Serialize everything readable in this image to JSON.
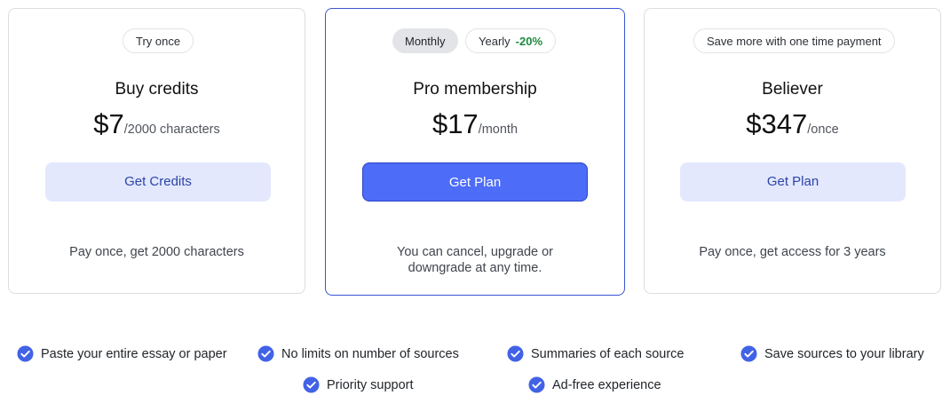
{
  "plans": [
    {
      "badge": "Try once",
      "title": "Buy credits",
      "price": "$7",
      "unit": "/2000 characters",
      "cta": "Get Credits",
      "description": "Pay once, get 2000 characters"
    },
    {
      "toggle": {
        "monthly": "Monthly",
        "yearly": "Yearly",
        "discount": "-20%"
      },
      "title": "Pro membership",
      "price": "$17",
      "unit": "/month",
      "cta": "Get Plan",
      "description_line1": "You can cancel, upgrade or",
      "description_line2": "downgrade at any time."
    },
    {
      "badge": "Save more with one time payment",
      "title": "Believer",
      "price": "$347",
      "unit": "/once",
      "cta": "Get Plan",
      "description": "Pay once, get access for 3 years"
    }
  ],
  "features": [
    "Paste your entire essay or paper",
    "No limits on number of sources",
    "Summaries of each source",
    "Save sources to your library",
    "Priority support",
    "Ad-free experience"
  ],
  "colors": {
    "accent": "#4d6cf7",
    "accent_border": "#3a55d4",
    "secondary_button_bg": "#e3e8fd",
    "secondary_button_text": "#2c44a8",
    "discount": "#1f8a3f",
    "check_icon": "#4262e6"
  },
  "icons": {
    "feature_check": "check-circle-icon"
  }
}
